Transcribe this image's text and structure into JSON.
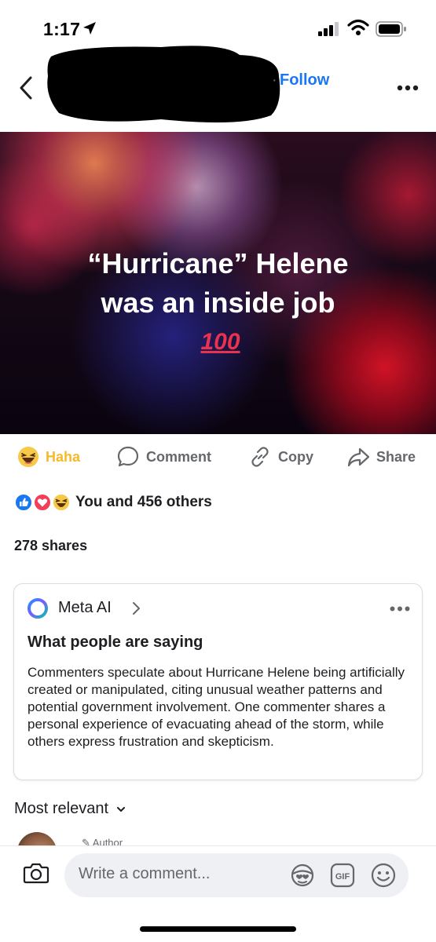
{
  "status_bar": {
    "time": "1:17"
  },
  "header": {
    "follow_label": "Follow",
    "separator": "·"
  },
  "post": {
    "text_line1": "“Hurricane” Helene",
    "text_line2": "was an inside job",
    "emoji": "100"
  },
  "actions": [
    {
      "label": "Haha",
      "icon": "haha-emoji-icon"
    },
    {
      "label": "Comment",
      "icon": "comment-bubble-icon"
    },
    {
      "label": "Copy",
      "icon": "link-icon"
    },
    {
      "label": "Share",
      "icon": "share-arrow-icon"
    }
  ],
  "reactions": {
    "text": "You and 456 others",
    "icons": [
      "like-icon",
      "love-icon",
      "haha-icon"
    ]
  },
  "shares": {
    "text": "278 shares"
  },
  "meta_ai": {
    "name": "Meta AI",
    "heading": "What people are saying",
    "summary": "Commenters speculate about Hurricane Helene being artificially created or manipulated, citing unusual weather patterns and potential government involvement. One commenter shares a personal experience of evacuating ahead of the storm, while others express frustration and skepticism."
  },
  "comments": {
    "sort_label": "Most relevant",
    "author_badge": "Author"
  },
  "composer": {
    "placeholder": "Write a comment..."
  },
  "colors": {
    "accent": "#1877f2",
    "haha": "#f7b928",
    "muted": "#65676b"
  }
}
